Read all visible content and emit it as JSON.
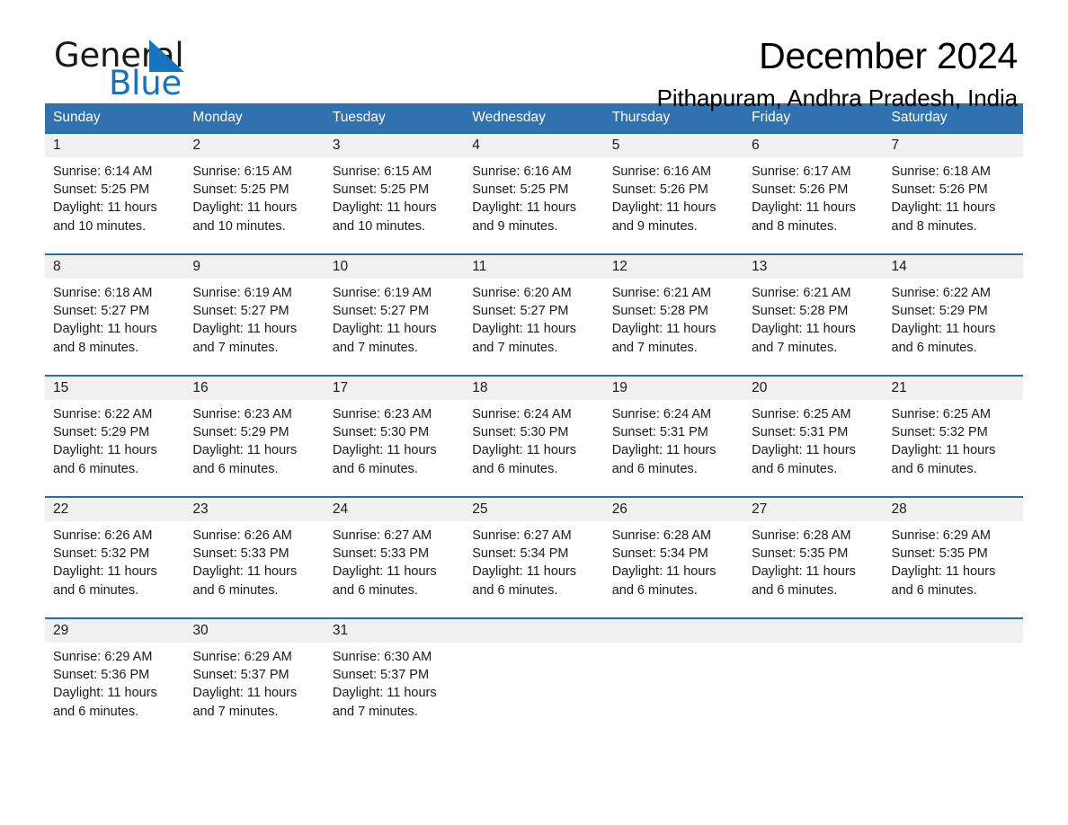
{
  "brand": {
    "name_part1": "General",
    "name_part2": "Blue",
    "accent_color": "#1673bd"
  },
  "header": {
    "title": "December 2024",
    "subtitle": "Pithapuram, Andhra Pradesh, India"
  },
  "calendar": {
    "header_bg": "#3071b0",
    "row_border_color": "#2e6da4",
    "daynum_bg": "#f0f0f0",
    "weekdays": [
      "Sunday",
      "Monday",
      "Tuesday",
      "Wednesday",
      "Thursday",
      "Friday",
      "Saturday"
    ],
    "weeks": [
      [
        {
          "day": "1",
          "sunrise": "Sunrise: 6:14 AM",
          "sunset": "Sunset: 5:25 PM",
          "daylight": "Daylight: 11 hours and 10 minutes."
        },
        {
          "day": "2",
          "sunrise": "Sunrise: 6:15 AM",
          "sunset": "Sunset: 5:25 PM",
          "daylight": "Daylight: 11 hours and 10 minutes."
        },
        {
          "day": "3",
          "sunrise": "Sunrise: 6:15 AM",
          "sunset": "Sunset: 5:25 PM",
          "daylight": "Daylight: 11 hours and 10 minutes."
        },
        {
          "day": "4",
          "sunrise": "Sunrise: 6:16 AM",
          "sunset": "Sunset: 5:25 PM",
          "daylight": "Daylight: 11 hours and 9 minutes."
        },
        {
          "day": "5",
          "sunrise": "Sunrise: 6:16 AM",
          "sunset": "Sunset: 5:26 PM",
          "daylight": "Daylight: 11 hours and 9 minutes."
        },
        {
          "day": "6",
          "sunrise": "Sunrise: 6:17 AM",
          "sunset": "Sunset: 5:26 PM",
          "daylight": "Daylight: 11 hours and 8 minutes."
        },
        {
          "day": "7",
          "sunrise": "Sunrise: 6:18 AM",
          "sunset": "Sunset: 5:26 PM",
          "daylight": "Daylight: 11 hours and 8 minutes."
        }
      ],
      [
        {
          "day": "8",
          "sunrise": "Sunrise: 6:18 AM",
          "sunset": "Sunset: 5:27 PM",
          "daylight": "Daylight: 11 hours and 8 minutes."
        },
        {
          "day": "9",
          "sunrise": "Sunrise: 6:19 AM",
          "sunset": "Sunset: 5:27 PM",
          "daylight": "Daylight: 11 hours and 7 minutes."
        },
        {
          "day": "10",
          "sunrise": "Sunrise: 6:19 AM",
          "sunset": "Sunset: 5:27 PM",
          "daylight": "Daylight: 11 hours and 7 minutes."
        },
        {
          "day": "11",
          "sunrise": "Sunrise: 6:20 AM",
          "sunset": "Sunset: 5:27 PM",
          "daylight": "Daylight: 11 hours and 7 minutes."
        },
        {
          "day": "12",
          "sunrise": "Sunrise: 6:21 AM",
          "sunset": "Sunset: 5:28 PM",
          "daylight": "Daylight: 11 hours and 7 minutes."
        },
        {
          "day": "13",
          "sunrise": "Sunrise: 6:21 AM",
          "sunset": "Sunset: 5:28 PM",
          "daylight": "Daylight: 11 hours and 7 minutes."
        },
        {
          "day": "14",
          "sunrise": "Sunrise: 6:22 AM",
          "sunset": "Sunset: 5:29 PM",
          "daylight": "Daylight: 11 hours and 6 minutes."
        }
      ],
      [
        {
          "day": "15",
          "sunrise": "Sunrise: 6:22 AM",
          "sunset": "Sunset: 5:29 PM",
          "daylight": "Daylight: 11 hours and 6 minutes."
        },
        {
          "day": "16",
          "sunrise": "Sunrise: 6:23 AM",
          "sunset": "Sunset: 5:29 PM",
          "daylight": "Daylight: 11 hours and 6 minutes."
        },
        {
          "day": "17",
          "sunrise": "Sunrise: 6:23 AM",
          "sunset": "Sunset: 5:30 PM",
          "daylight": "Daylight: 11 hours and 6 minutes."
        },
        {
          "day": "18",
          "sunrise": "Sunrise: 6:24 AM",
          "sunset": "Sunset: 5:30 PM",
          "daylight": "Daylight: 11 hours and 6 minutes."
        },
        {
          "day": "19",
          "sunrise": "Sunrise: 6:24 AM",
          "sunset": "Sunset: 5:31 PM",
          "daylight": "Daylight: 11 hours and 6 minutes."
        },
        {
          "day": "20",
          "sunrise": "Sunrise: 6:25 AM",
          "sunset": "Sunset: 5:31 PM",
          "daylight": "Daylight: 11 hours and 6 minutes."
        },
        {
          "day": "21",
          "sunrise": "Sunrise: 6:25 AM",
          "sunset": "Sunset: 5:32 PM",
          "daylight": "Daylight: 11 hours and 6 minutes."
        }
      ],
      [
        {
          "day": "22",
          "sunrise": "Sunrise: 6:26 AM",
          "sunset": "Sunset: 5:32 PM",
          "daylight": "Daylight: 11 hours and 6 minutes."
        },
        {
          "day": "23",
          "sunrise": "Sunrise: 6:26 AM",
          "sunset": "Sunset: 5:33 PM",
          "daylight": "Daylight: 11 hours and 6 minutes."
        },
        {
          "day": "24",
          "sunrise": "Sunrise: 6:27 AM",
          "sunset": "Sunset: 5:33 PM",
          "daylight": "Daylight: 11 hours and 6 minutes."
        },
        {
          "day": "25",
          "sunrise": "Sunrise: 6:27 AM",
          "sunset": "Sunset: 5:34 PM",
          "daylight": "Daylight: 11 hours and 6 minutes."
        },
        {
          "day": "26",
          "sunrise": "Sunrise: 6:28 AM",
          "sunset": "Sunset: 5:34 PM",
          "daylight": "Daylight: 11 hours and 6 minutes."
        },
        {
          "day": "27",
          "sunrise": "Sunrise: 6:28 AM",
          "sunset": "Sunset: 5:35 PM",
          "daylight": "Daylight: 11 hours and 6 minutes."
        },
        {
          "day": "28",
          "sunrise": "Sunrise: 6:29 AM",
          "sunset": "Sunset: 5:35 PM",
          "daylight": "Daylight: 11 hours and 6 minutes."
        }
      ],
      [
        {
          "day": "29",
          "sunrise": "Sunrise: 6:29 AM",
          "sunset": "Sunset: 5:36 PM",
          "daylight": "Daylight: 11 hours and 6 minutes."
        },
        {
          "day": "30",
          "sunrise": "Sunrise: 6:29 AM",
          "sunset": "Sunset: 5:37 PM",
          "daylight": "Daylight: 11 hours and 7 minutes."
        },
        {
          "day": "31",
          "sunrise": "Sunrise: 6:30 AM",
          "sunset": "Sunset: 5:37 PM",
          "daylight": "Daylight: 11 hours and 7 minutes."
        },
        {
          "day": "",
          "sunrise": "",
          "sunset": "",
          "daylight": ""
        },
        {
          "day": "",
          "sunrise": "",
          "sunset": "",
          "daylight": ""
        },
        {
          "day": "",
          "sunrise": "",
          "sunset": "",
          "daylight": ""
        },
        {
          "day": "",
          "sunrise": "",
          "sunset": "",
          "daylight": ""
        }
      ]
    ]
  }
}
